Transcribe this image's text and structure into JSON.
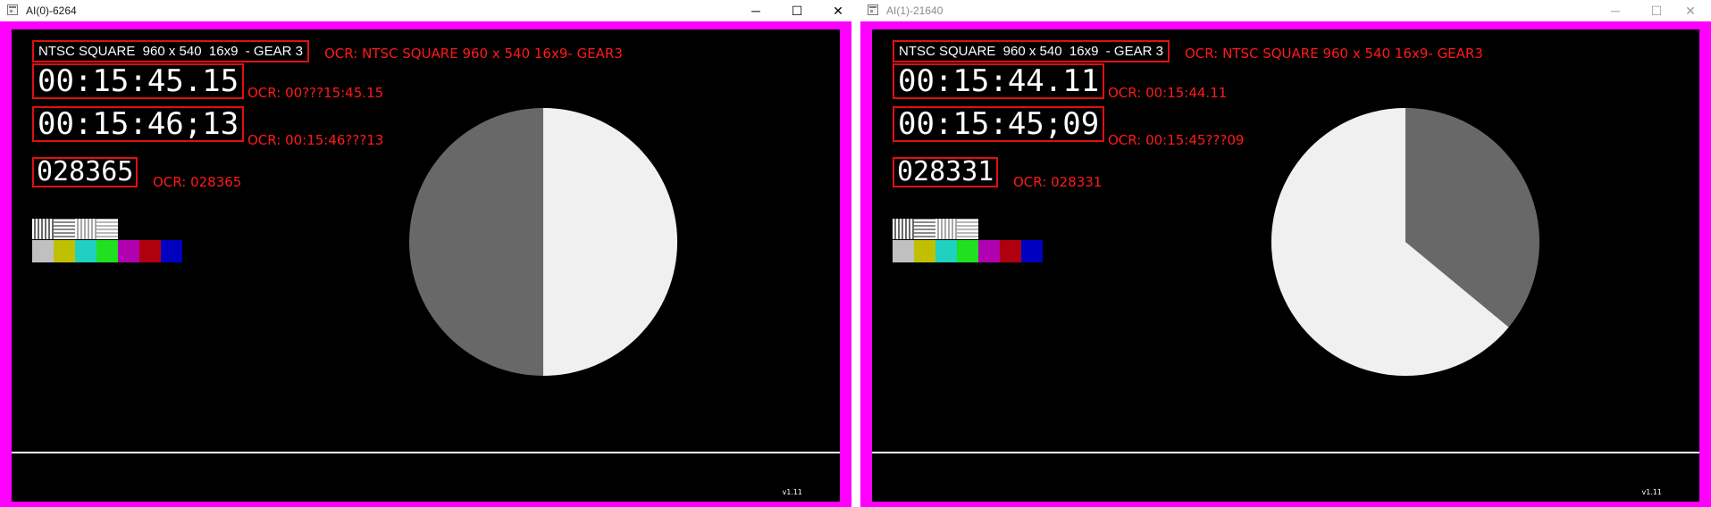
{
  "windows": [
    {
      "title": "AI(0)-6264",
      "title_color": "#1a1a1a",
      "controls": {
        "minimize": "─",
        "maximize": "☐",
        "close": "✕"
      },
      "gear_label": "NTSC SQUARE  960 x 540  16x9  - GEAR 3",
      "gear_ocr": "OCR: NTSC SQUARE 960 x 540 16x9- GEAR3",
      "timecode_1": "00:15:45.15",
      "timecode_1_ocr": "OCR: 00???15:45.15",
      "timecode_2": "00:15:46;13",
      "timecode_2_ocr": "OCR: 00:15:46???13",
      "frame_count": "028365",
      "frame_count_ocr": "OCR: 028365",
      "pie_light_fraction": 0.5,
      "version": "v1.11"
    },
    {
      "title": "AI(1)-21640",
      "title_color": "#8a8a8a",
      "controls": {
        "minimize": "─",
        "maximize": "☐",
        "close": "✕"
      },
      "gear_label": "NTSC SQUARE  960 x 540  16x9  - GEAR 3",
      "gear_ocr": "OCR: NTSC SQUARE 960 x 540 16x9- GEAR3",
      "timecode_1": "00:15:44.11",
      "timecode_1_ocr": "OCR: 00:15:44.11",
      "timecode_2": "00:15:45;09",
      "timecode_2_ocr": "OCR: 00:15:45???09",
      "frame_count": "028331",
      "frame_count_ocr": "OCR: 028331",
      "pie_light_fraction": 0.64,
      "version": "v1.11"
    }
  ],
  "colors": {
    "frame_border": "#ff00ff",
    "ocr_box": "#e01010",
    "ocr_text": "#ff1a1a",
    "pie_light": "#f0f0f0",
    "pie_dark": "#686868"
  },
  "gray_patches": [
    "#6a6a6a",
    "#8a8a8a",
    "#a8a8a8",
    "#b8b8b8"
  ],
  "color_bars": [
    "#c0c0c0",
    "#c0c000",
    "#20d0c0",
    "#20e020",
    "#b000b0",
    "#b00010",
    "#0000c0"
  ]
}
